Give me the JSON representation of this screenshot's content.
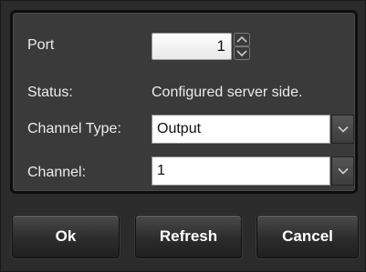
{
  "form": {
    "port": {
      "label": "Port",
      "value": "1"
    },
    "status": {
      "label": "Status:",
      "value": "Configured server side."
    },
    "channel_type": {
      "label": "Channel Type:",
      "value": "Output"
    },
    "channel": {
      "label": "Channel:",
      "value": "1"
    }
  },
  "buttons": {
    "ok": "Ok",
    "refresh": "Refresh",
    "cancel": "Cancel"
  }
}
